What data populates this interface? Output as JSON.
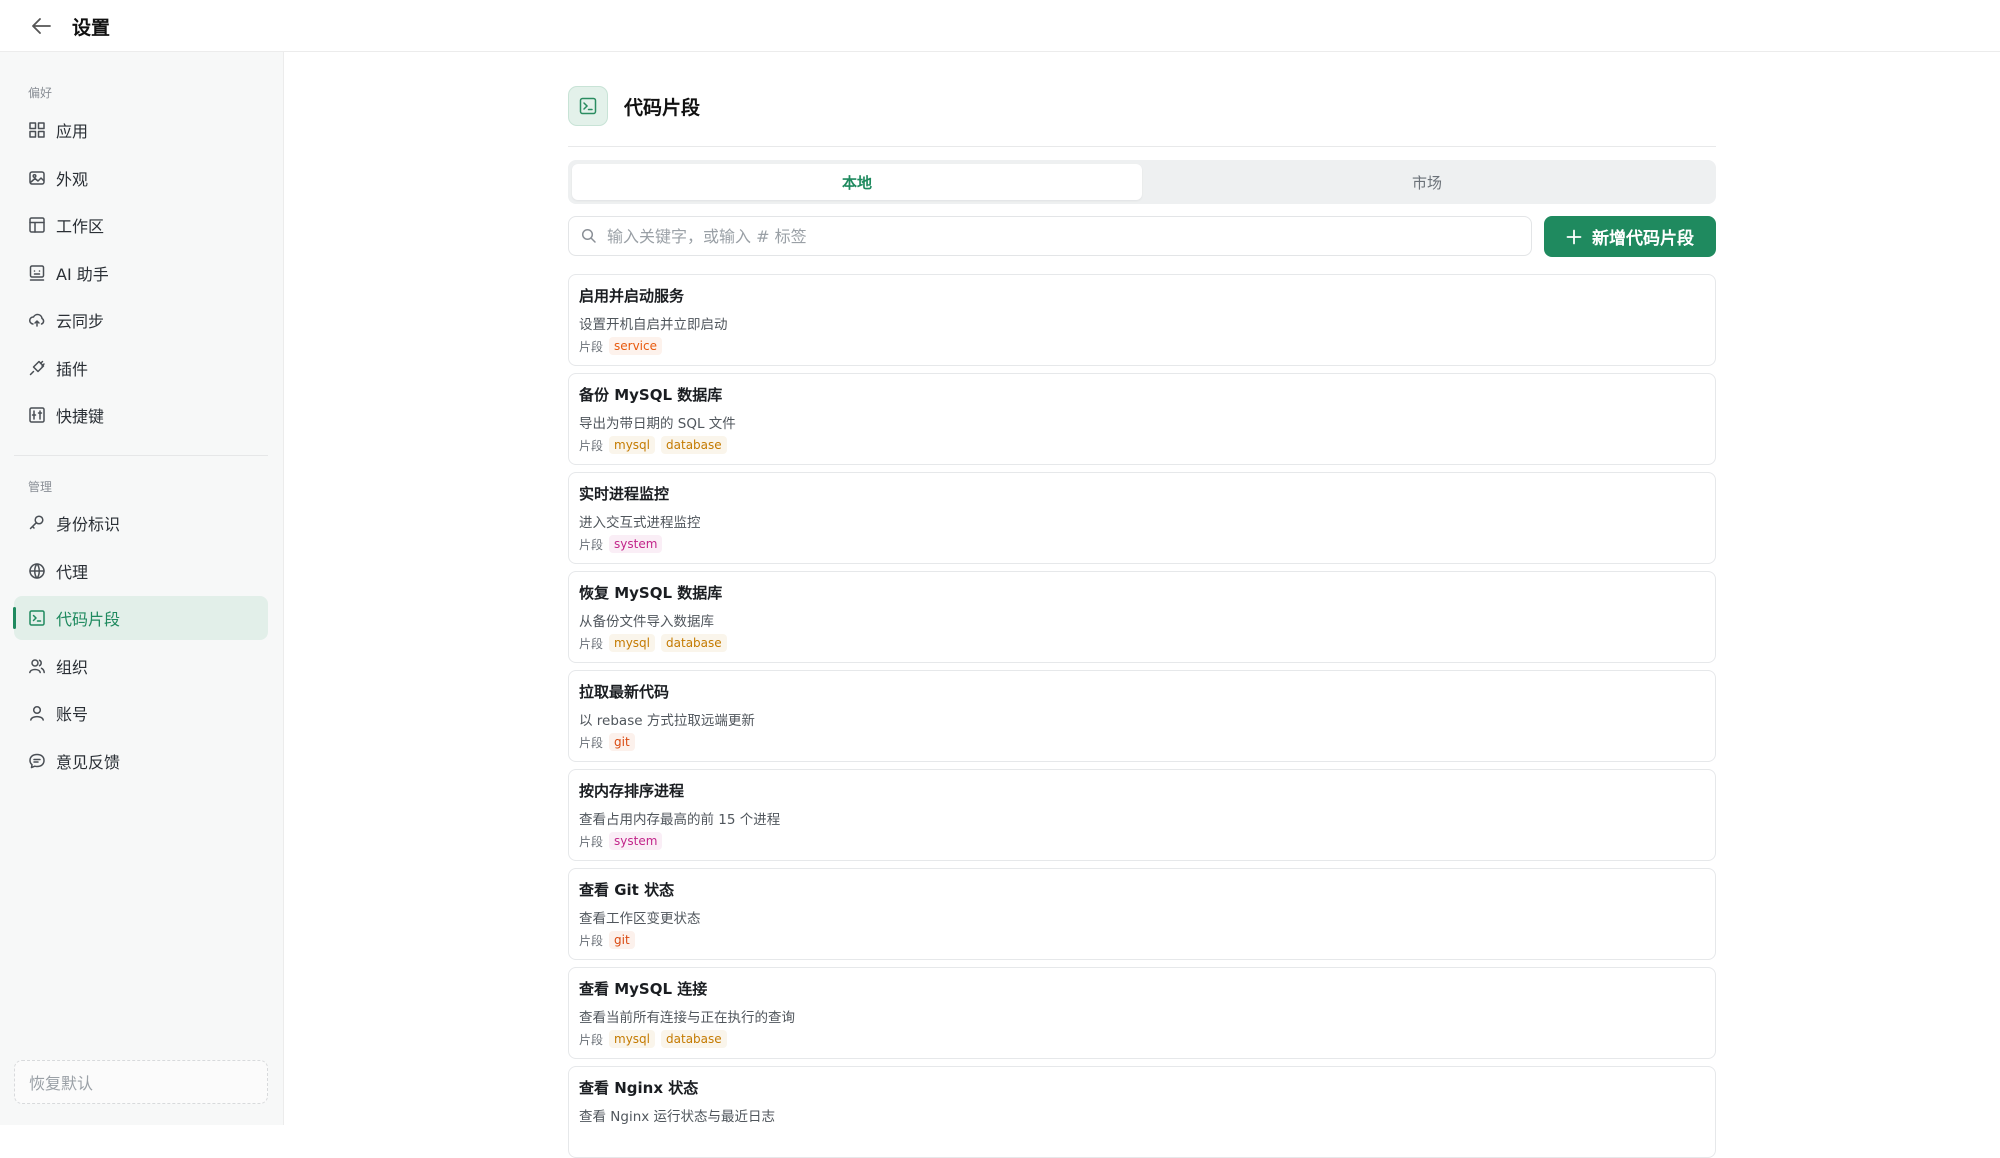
{
  "window": {
    "title": "设置"
  },
  "sidebar": {
    "group1": "偏好",
    "group2": "管理",
    "items": [
      {
        "label": "应用",
        "icon": "grid-icon"
      },
      {
        "label": "外观",
        "icon": "image-icon"
      },
      {
        "label": "工作区",
        "icon": "layout-icon"
      },
      {
        "label": "AI 助手",
        "icon": "bot-icon"
      },
      {
        "label": "云同步",
        "icon": "cloud-sync-icon"
      },
      {
        "label": "插件",
        "icon": "plug-icon"
      },
      {
        "label": "快捷键",
        "icon": "shortcut-icon"
      },
      {
        "label": "身份标识",
        "icon": "key-icon"
      },
      {
        "label": "代理",
        "icon": "globe-icon"
      },
      {
        "label": "代码片段",
        "icon": "terminal-icon"
      },
      {
        "label": "组织",
        "icon": "team-icon"
      },
      {
        "label": "账号",
        "icon": "user-icon"
      },
      {
        "label": "意见反馈",
        "icon": "chat-icon"
      }
    ],
    "active_index": 9,
    "reset_label": "恢复默认"
  },
  "main": {
    "title": "代码片段",
    "tabs": [
      "本地",
      "市场"
    ],
    "active_tab": 0,
    "search_placeholder": "输入关键字，或输入 # 标签",
    "add_label": "新增代码片段",
    "kind_label": "片段",
    "snippets": [
      {
        "title": "启用并启动服务",
        "desc": "设置开机自启并立即启动",
        "tags": [
          "service"
        ]
      },
      {
        "title": "备份 MySQL 数据库",
        "desc": "导出为带日期的 SQL 文件",
        "tags": [
          "mysql",
          "database"
        ]
      },
      {
        "title": "实时进程监控",
        "desc": "进入交互式进程监控",
        "tags": [
          "system"
        ]
      },
      {
        "title": "恢复 MySQL 数据库",
        "desc": "从备份文件导入数据库",
        "tags": [
          "mysql",
          "database"
        ]
      },
      {
        "title": "拉取最新代码",
        "desc": "以 rebase 方式拉取远端更新",
        "tags": [
          "git"
        ]
      },
      {
        "title": "按内存排序进程",
        "desc": "查看占用内存最高的前 15 个进程",
        "tags": [
          "system"
        ]
      },
      {
        "title": "查看 Git 状态",
        "desc": "查看工作区变更状态",
        "tags": [
          "git"
        ]
      },
      {
        "title": "查看 MySQL 连接",
        "desc": "查看当前所有连接与正在执行的查询",
        "tags": [
          "mysql",
          "database"
        ]
      },
      {
        "title": "查看 Nginx 状态",
        "desc": "查看 Nginx 运行状态与最近日志",
        "tags": []
      }
    ]
  },
  "colors": {
    "accent": "#1f8a5f",
    "tag_service": "#e8590c",
    "tag_mysql": "#c47a00",
    "tag_database": "#c47a00",
    "tag_system": "#c2258a",
    "tag_git": "#d9480f"
  }
}
